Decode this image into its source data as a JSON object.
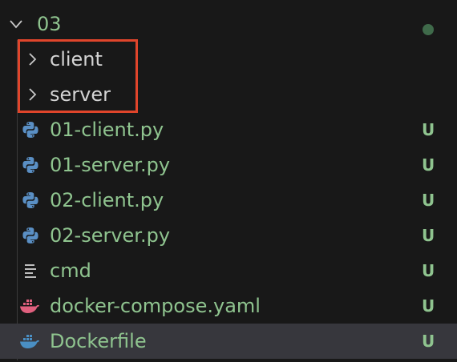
{
  "root": {
    "label": "03",
    "expanded": true,
    "status_dot_color": "#3f6a4a"
  },
  "folders": [
    {
      "label": "client",
      "expanded": false
    },
    {
      "label": "server",
      "expanded": false
    }
  ],
  "files": [
    {
      "label": "01-client.py",
      "icon": "python-icon",
      "status": "U"
    },
    {
      "label": "01-server.py",
      "icon": "python-icon",
      "status": "U"
    },
    {
      "label": "02-client.py",
      "icon": "python-icon",
      "status": "U"
    },
    {
      "label": "02-server.py",
      "icon": "python-icon",
      "status": "U"
    },
    {
      "label": "cmd",
      "icon": "text-lines-icon",
      "status": "U"
    },
    {
      "label": "docker-compose.yaml",
      "icon": "docker-compose-icon",
      "status": "U"
    },
    {
      "label": "Dockerfile",
      "icon": "docker-icon",
      "status": "U",
      "selected": true
    }
  ],
  "colors": {
    "untracked_text": "#8fc48f",
    "folder_text": "#d4d4d4",
    "highlight_border": "#e0452b",
    "selected_row_bg": "#37373d",
    "python_blue": "#5a8fc4",
    "docker_pink": "#e0607e",
    "docker_blue": "#4a8fc4"
  }
}
